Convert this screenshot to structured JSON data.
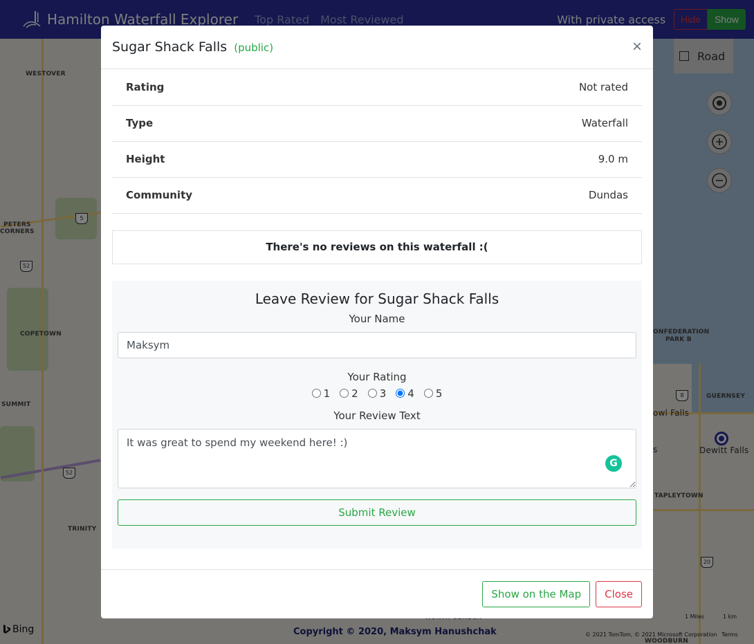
{
  "navbar": {
    "brand": "Hamilton Waterfall Explorer",
    "links": [
      "Top Rated",
      "Most Reviewed"
    ],
    "access_text": "With private access",
    "hide_label": "Hide",
    "show_label": "Show"
  },
  "map": {
    "road_label": "Road",
    "labels": [
      "WESTOVER",
      "PETERS",
      "CORNERS",
      "COPETOWN",
      "SUMMIT",
      "TRINITY",
      "ONFEDERATION",
      "PARK B",
      "GUERNSEY",
      "owl Falls",
      "s",
      "Dewitt Falls",
      "TAPLEYTOWN",
      "NORTH SENECA",
      "WOODBURN"
    ],
    "shields": [
      "5",
      "52",
      "52",
      "8",
      "20"
    ],
    "bing": "Bing",
    "copyright": "Copyright © 2020, Maksym Hanushchak",
    "attribution": "© 2021 TomTom, © 2021 Microsoft Corporation",
    "terms": "Terms",
    "scale_miles": "1 Miles",
    "scale_km": "1 km"
  },
  "modal": {
    "title": "Sugar Shack Falls",
    "visibility": "(public)",
    "close_symbol": "×",
    "info": [
      {
        "key": "Rating",
        "value": "Not rated"
      },
      {
        "key": "Type",
        "value": "Waterfall"
      },
      {
        "key": "Height",
        "value": "9.0 m"
      },
      {
        "key": "Community",
        "value": "Dundas"
      }
    ],
    "no_reviews": "There's no reviews on this waterfall :(",
    "review": {
      "title": "Leave Review for Sugar Shack Falls",
      "name_label": "Your Name",
      "name_value": "Maksym",
      "rating_label": "Your Rating",
      "rating_options": [
        "1",
        "2",
        "3",
        "4",
        "5"
      ],
      "rating_selected": "4",
      "text_label": "Your Review Text",
      "text_value": "It was great to spend my weekend here! :)",
      "submit_label": "Submit Review"
    },
    "footer": {
      "map_label": "Show on the Map",
      "close_label": "Close"
    }
  }
}
